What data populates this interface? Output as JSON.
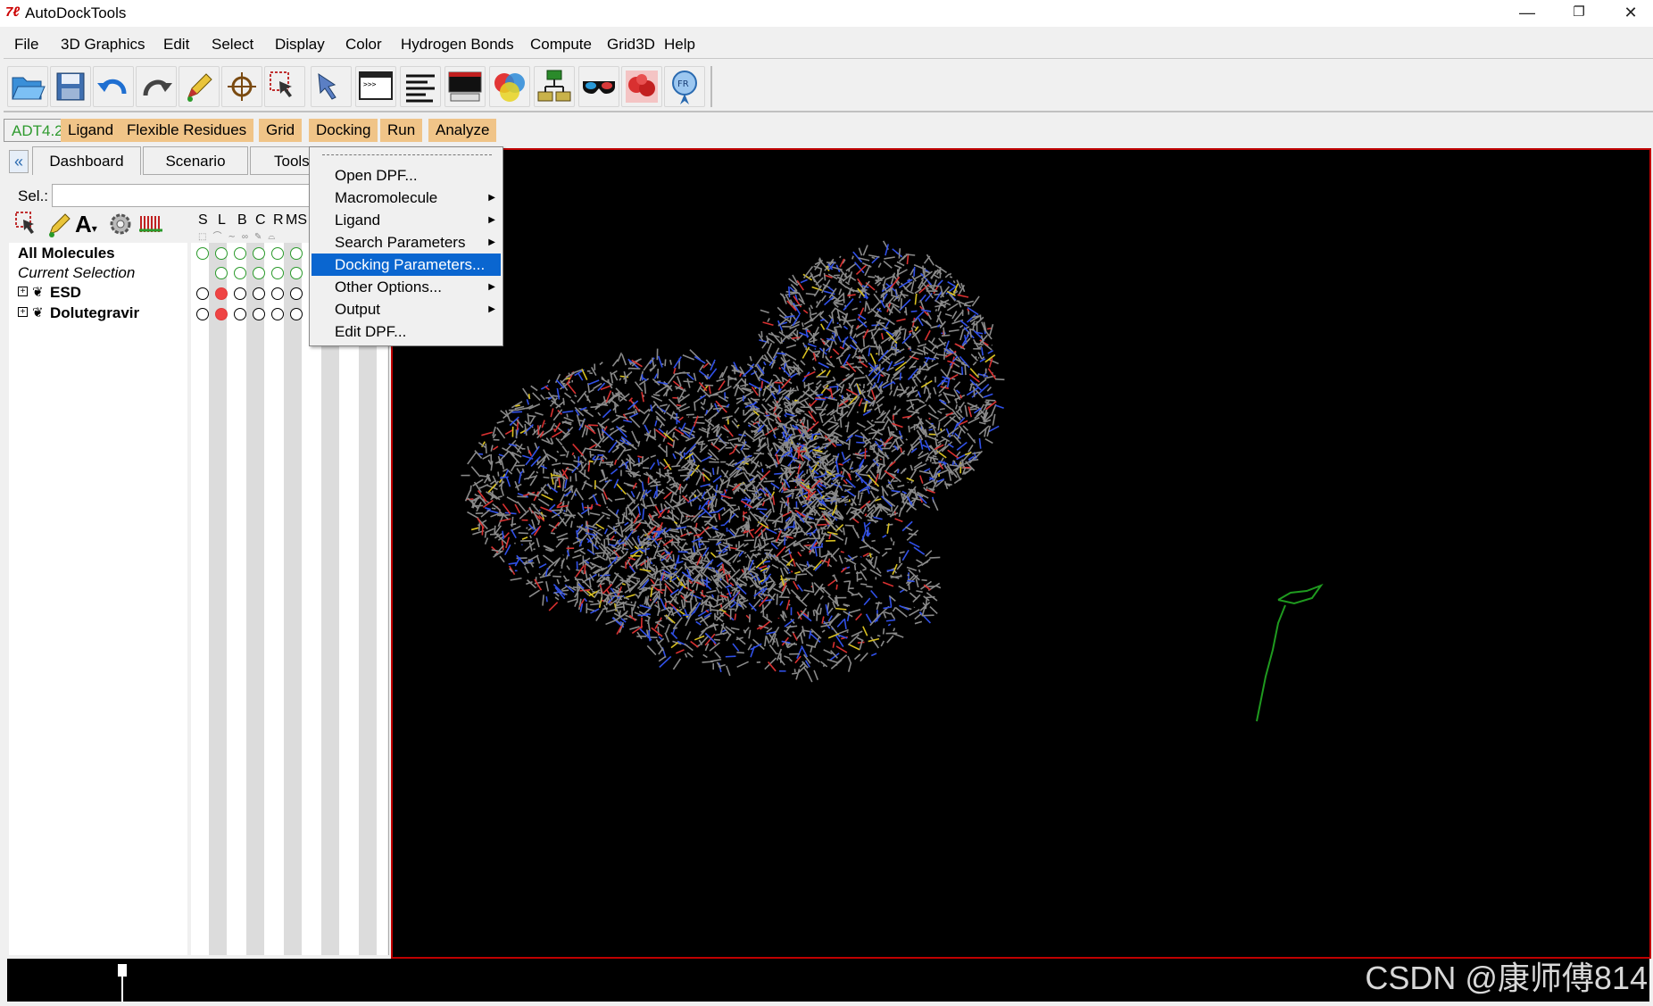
{
  "window": {
    "title": "AutoDockTools",
    "minimize": "—",
    "restore": "❐",
    "close": "✕"
  },
  "menubar": [
    "File",
    "3D Graphics",
    "Edit",
    "Select",
    "Display",
    "Color",
    "Hydrogen Bonds",
    "Compute",
    "Grid3D",
    "Help"
  ],
  "toolbar_icons": [
    "open-folder-icon",
    "save-icon",
    "undo-icon",
    "redo-icon",
    "pencil-icon",
    "crosshair-icon",
    "selection-icon",
    "pointer-icon",
    "python-shell-icon",
    "text-lines-icon",
    "monitor-icon",
    "color-sphere-icon",
    "network-icon",
    "stereo-glasses-icon",
    "molecule-image-icon",
    "info-badge-icon"
  ],
  "modules": {
    "version": "ADT4.2",
    "tabs": [
      "Ligand",
      "Flexible Residues",
      "Grid",
      "Docking",
      "Run",
      "Analyze"
    ]
  },
  "panel": {
    "tabs": [
      "Dashboard",
      "Scenario",
      "Tools"
    ],
    "sel_label": "Sel.:",
    "columns": [
      "S",
      "L",
      "B",
      "C",
      "R",
      "MS"
    ],
    "rows": [
      {
        "label": "All Molecules"
      },
      {
        "label": "Current Selection"
      },
      {
        "label": "ESD"
      },
      {
        "label": "Dolutegravir"
      }
    ]
  },
  "docking_menu": {
    "items": [
      {
        "label": "Open DPF...",
        "submenu": false
      },
      {
        "label": "Macromolecule",
        "submenu": true
      },
      {
        "label": "Ligand",
        "submenu": true
      },
      {
        "label": "Search Parameters",
        "submenu": true
      },
      {
        "label": "Docking Parameters...",
        "submenu": false,
        "selected": true
      },
      {
        "label": "Other Options...",
        "submenu": true
      },
      {
        "label": "Output",
        "submenu": true
      },
      {
        "label": "Edit DPF...",
        "submenu": false
      }
    ]
  },
  "watermark": "CSDN @康师傅814",
  "colors": {
    "module_tab_bg": "#f0c488",
    "version_text": "#2e9a2e",
    "menu_highlight": "#0a66d0",
    "viewer_border": "#c00000",
    "viewer_bg": "#000000"
  }
}
